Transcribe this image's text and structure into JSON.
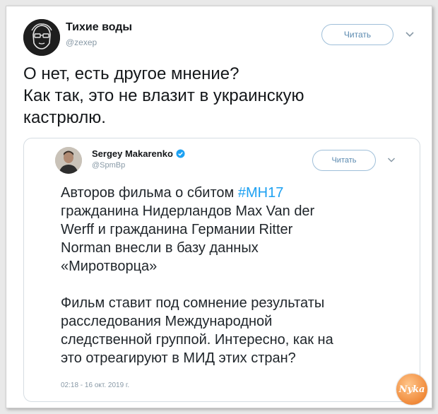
{
  "tweet": {
    "author_name": "Тихие воды",
    "author_handle": "@zexep",
    "follow_label": "Читать",
    "text_lines": [
      "О нет, есть другое мнение?",
      "Как так, это не влазит в украинскую",
      "кастрюлю."
    ]
  },
  "quoted_tweet": {
    "author_name": "Sergey Makarenko",
    "author_handle": "@SpmBp",
    "follow_label": "Читать",
    "paragraph1": {
      "line1_prefix": "Авторов фильма о сбитом ",
      "line1_hashtag": "#MH17",
      "lines": [
        "гражданина Нидерландов Max Van der",
        "Werff и гражданина Германии Ritter",
        "Norman внесли в базу данных",
        "«Миротворца»"
      ]
    },
    "paragraph2": [
      "Фильм ставит под сомнение результаты",
      "расследования Международной",
      "следственной группой. Интересно, как на",
      "это отреагируют в МИД этих стран?"
    ],
    "timestamp": "02:18 - 16 окт. 2019 г."
  },
  "colors": {
    "link": "#1da1f2",
    "follow_border": "#9fbfd9",
    "muted": "#8899a6"
  },
  "watermark_text": "Nyka"
}
